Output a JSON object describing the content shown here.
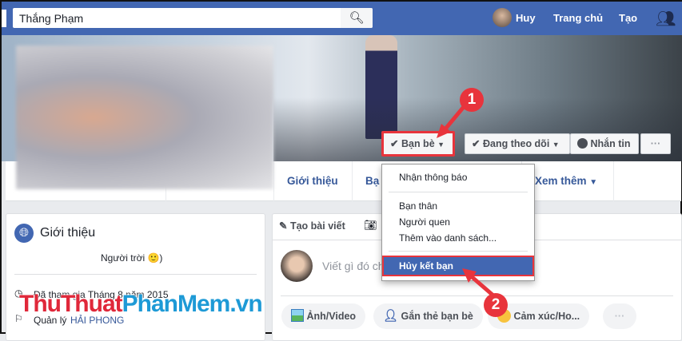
{
  "header": {
    "search_value": "Thắng Phạm",
    "user": "Huy",
    "home": "Trang chủ",
    "create": "Tạo"
  },
  "profile_actions": {
    "friends": "Bạn bè",
    "following": "Đang theo dõi",
    "message": "Nhắn tin",
    "more": "···"
  },
  "tabs": [
    {
      "label": "Giới thiệu"
    },
    {
      "label": "Bạ"
    },
    {
      "label": "Xem thêm"
    }
  ],
  "friends_menu": {
    "items": [
      "Nhận thông báo",
      "Bạn thân",
      "Người quen",
      "Thêm vào danh sách...",
      "Hủy kết bạn"
    ],
    "highlighted": "Hủy kết bạn"
  },
  "intro": {
    "title": "Giới thiệu",
    "bio": "Người trời 🙂)",
    "joined": "Đã tham gia Tháng 8 năm 2015",
    "manages_prefix": "Quản lý",
    "manages_link": "HẢI PHONG"
  },
  "composer": {
    "tab_create": "Tạo bài viết",
    "placeholder": "Viết gì đó cho",
    "actions": [
      "Ảnh/Video",
      "Gắn thẻ bạn bè",
      "Cảm xúc/Ho...",
      "···"
    ]
  },
  "annotations": [
    "1",
    "2"
  ],
  "watermark": {
    "part1": "ThuThuat",
    "part2": "PhanMem.vn"
  },
  "colors": {
    "brand": "#4267b2",
    "annotation": "#e8343c"
  }
}
